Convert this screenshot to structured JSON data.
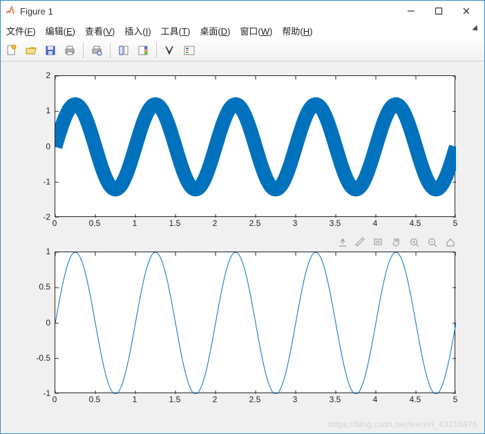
{
  "window": {
    "title": "Figure 1"
  },
  "menubar": {
    "items": [
      {
        "label": "文件(F)",
        "u": "F"
      },
      {
        "label": "编辑(E)",
        "u": "E"
      },
      {
        "label": "查看(V)",
        "u": "V"
      },
      {
        "label": "插入(I)",
        "u": "I"
      },
      {
        "label": "工具(T)",
        "u": "T"
      },
      {
        "label": "桌面(D)",
        "u": "D"
      },
      {
        "label": "窗口(W)",
        "u": "W"
      },
      {
        "label": "帮助(H)",
        "u": "H"
      }
    ]
  },
  "toolbar": {
    "buttons": [
      "new-figure",
      "open",
      "save",
      "print",
      "|",
      "print-preview",
      "|",
      "data-cursor",
      "color-legend",
      "|",
      "edit-plot",
      "insert-legend"
    ]
  },
  "axes_tools": {
    "buttons": [
      "export",
      "brush",
      "data-tips",
      "pan",
      "zoom-in",
      "zoom-out",
      "home"
    ]
  },
  "chart_data": [
    {
      "type": "line",
      "style": "thick-band",
      "x_range": [
        0,
        5
      ],
      "dx": 0.01,
      "amplitude_inner": 1.0,
      "amplitude_outer": 1.4,
      "frequency_hz": 1.0,
      "phase": 0,
      "title": "",
      "xlabel": "",
      "ylabel": "",
      "xlim": [
        0,
        5
      ],
      "ylim": [
        -2,
        2
      ],
      "xticks": [
        0,
        0.5,
        1,
        1.5,
        2,
        2.5,
        3,
        3.5,
        4,
        4.5,
        5
      ],
      "yticks": [
        -2,
        -1,
        0,
        1,
        2
      ],
      "color": "#0072BD",
      "description": "Area between sin(2πx) with amplitude ≈1.0 and amplitude ≈1.4"
    },
    {
      "type": "line",
      "style": "thin-line",
      "x_range": [
        0,
        5
      ],
      "dx": 0.01,
      "amplitude": 1.0,
      "frequency_hz": 1.0,
      "phase": 0,
      "title": "",
      "xlabel": "",
      "ylabel": "",
      "xlim": [
        0,
        5
      ],
      "ylim": [
        -1,
        1
      ],
      "xticks": [
        0,
        0.5,
        1,
        1.5,
        2,
        2.5,
        3,
        3.5,
        4,
        4.5,
        5
      ],
      "yticks": [
        -1,
        -0.5,
        0,
        0.5,
        1
      ],
      "color": "#0072BD",
      "description": "y = sin(2πx)"
    }
  ],
  "colors": {
    "line": "#0072BD",
    "window_border": "#2a8dd4",
    "plot_bg": "#f0f0f0"
  },
  "watermark": "https://blog.csdn.net/weixin_43216875"
}
